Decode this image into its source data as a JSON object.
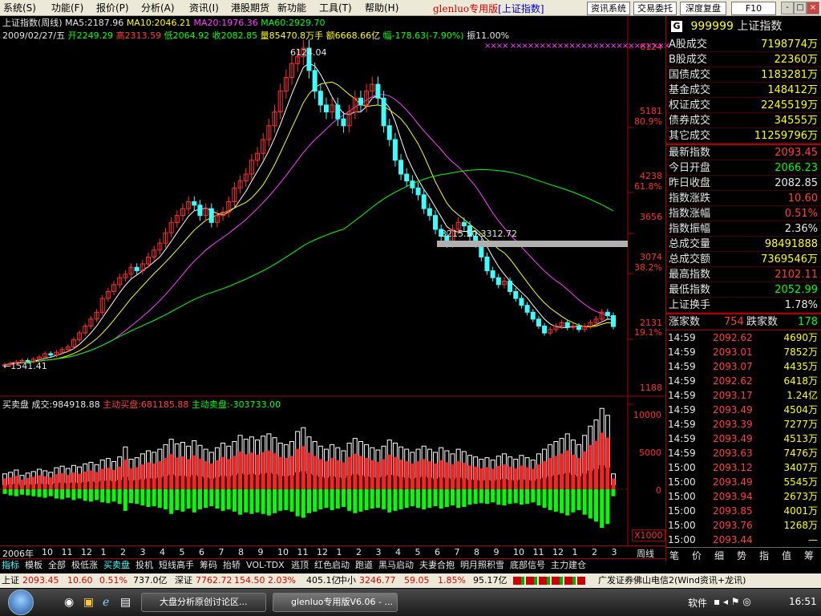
{
  "menu": {
    "items": [
      "系统(S)",
      "功能(F)",
      "报价(P)",
      "分析(A)",
      "资讯(I)",
      "港股期货",
      "新功能",
      "工具(T)",
      "帮助(H)"
    ],
    "app_name": "glenluo专用版",
    "app_index": "[上证指数]",
    "buttons": [
      "资讯系统",
      "交易委托",
      "深度复盘",
      "F10"
    ],
    "window_buttons": [
      "-",
      "□",
      "×"
    ]
  },
  "chart_header": {
    "line1": {
      "name": "上证指数(周线)",
      "ma5": "MA5:2187.96",
      "ma10": "MA10:2046.21",
      "ma20": "MA20:1976.36",
      "ma60": "MA60:2929.70"
    },
    "line2": {
      "date": "2009/02/27/五",
      "open": "开2249.29",
      "high": "高2313.59",
      "low": "低2064.92",
      "close": "收2082.85",
      "vol": "量85470.8万手",
      "amount": "额6668.66亿",
      "change": "幅-178.63(-7.90%)",
      "amp": "振11.00%"
    }
  },
  "price_axis_labels": [
    "6124",
    "5181",
    "80.9%",
    "4238",
    "61.8%",
    "3656",
    "3074",
    "38.2%",
    "2131",
    "19.1%",
    "1188"
  ],
  "annotations": {
    "peak": "6124.04",
    "low": "←1541.41",
    "gap": "3215.50-3312.72"
  },
  "sub_header": {
    "name": "买卖盘",
    "total": "成交:984918.88",
    "active_buy": "主动买盘:681185.88",
    "active_sell": "主动卖盘:-303733.00"
  },
  "sub_axis_labels": [
    "10000",
    "5000",
    "0"
  ],
  "sub_multiplier": "X1000",
  "time_axis": {
    "labels": [
      "2006年",
      "10",
      "11",
      "12",
      "1",
      "2",
      "3",
      "4",
      "5",
      "6",
      "7",
      "8",
      "9",
      "10",
      "11",
      "12",
      "1",
      "2",
      "3",
      "4",
      "5",
      "6",
      "7",
      "8",
      "9",
      "10",
      "11",
      "12",
      "1",
      "2",
      "3"
    ],
    "period": "周线"
  },
  "bottom_tabs": [
    "指标",
    "模板",
    "全部",
    "极低涨",
    "买卖盘",
    "投机",
    "短线高手",
    "筹码",
    "抬轿",
    "VOL-TDX",
    "逃顶",
    "红色启动",
    "跑道",
    "黑马启动",
    "夫妻合抱",
    "明月照积雪",
    "底部信号",
    "主力建仓"
  ],
  "right_panel": {
    "code": "999999",
    "name": "上证指数",
    "badge": "G",
    "volume_rows": [
      {
        "label": "A股成交",
        "value": "7198774万"
      },
      {
        "label": "B股成交",
        "value": "22360万"
      },
      {
        "label": "国债成交",
        "value": "1183281万"
      },
      {
        "label": "基金成交",
        "value": "148412万"
      },
      {
        "label": "权证成交",
        "value": "2245519万"
      },
      {
        "label": "债券成交",
        "value": "34555万"
      },
      {
        "label": "其它成交",
        "value": "11259796万"
      }
    ],
    "index_rows": [
      {
        "label": "最新指数",
        "value": "2093.45",
        "color": "#ff4040"
      },
      {
        "label": "今日开盘",
        "value": "2066.23",
        "color": "#00ff00"
      },
      {
        "label": "昨日收盘",
        "value": "2082.85",
        "color": "#e6e6e6"
      },
      {
        "label": "指数涨跌",
        "value": "10.60",
        "color": "#ff4040"
      },
      {
        "label": "指数涨幅",
        "value": "0.51%",
        "color": "#ff4040"
      },
      {
        "label": "指数振幅",
        "value": "2.36%",
        "color": "#e6e6e6"
      },
      {
        "label": "总成交量",
        "value": "98491888",
        "color": "#ffff00"
      },
      {
        "label": "总成交额",
        "value": "7369546万",
        "color": "#ffff00"
      },
      {
        "label": "最高指数",
        "value": "2102.11",
        "color": "#ff4040"
      },
      {
        "label": "最低指数",
        "value": "2052.99",
        "color": "#00ff00"
      },
      {
        "label": "上证换手",
        "value": "1.78%",
        "color": "#e6e6e6"
      }
    ],
    "advance_label": "涨家数",
    "advance_value": "754",
    "decline_label": "跌家数",
    "decline_value": "178",
    "trades": [
      {
        "time": "14:59",
        "price": "2092.62",
        "qty": "4690万"
      },
      {
        "time": "14:59",
        "price": "2093.01",
        "qty": "7852万"
      },
      {
        "time": "14:59",
        "price": "2093.07",
        "qty": "4435万"
      },
      {
        "time": "14:59",
        "price": "2092.62",
        "qty": "6418万"
      },
      {
        "time": "14:59",
        "price": "2093.17",
        "qty": "1.24亿"
      },
      {
        "time": "14:59",
        "price": "2093.49",
        "qty": "4504万"
      },
      {
        "time": "14:59",
        "price": "2093.39",
        "qty": "7277万"
      },
      {
        "time": "14:59",
        "price": "2093.49",
        "qty": "4513万"
      },
      {
        "time": "14:59",
        "price": "2093.63",
        "qty": "7476万"
      },
      {
        "time": "15:00",
        "price": "2093.12",
        "qty": "3407万"
      },
      {
        "time": "15:00",
        "price": "2093.49",
        "qty": "5545万"
      },
      {
        "time": "15:00",
        "price": "2093.94",
        "qty": "2673万"
      },
      {
        "time": "15:00",
        "price": "2093.85",
        "qty": "4001万"
      },
      {
        "time": "15:00",
        "price": "2093.76",
        "qty": "1268万"
      },
      {
        "time": "15:00",
        "price": "2093.44",
        "qty": "—"
      }
    ],
    "tabs": [
      "笔",
      "价",
      "细",
      "势",
      "指",
      "值",
      "筹"
    ]
  },
  "status_bar": {
    "sh_label": "上证",
    "sh_value": "2093.45",
    "sh_chg": "10.60",
    "sh_pct": "0.51%",
    "sh_amt": "737.0亿",
    "sz_label": "深证",
    "sz_value": "7762.72",
    "sz_chg": "154.50",
    "sz_pct": "2.03%",
    "sz_amt": "405.1亿",
    "zx_label": "中小",
    "zx_value": "3246.77",
    "zx_chg": "59.05",
    "zx_pct": "1.85%",
    "zx_amt": "95.17亿",
    "broker": "广发证券佛山电信2(Wind资讯+龙讯)"
  },
  "taskbar": {
    "tasks": [
      "大盘分析原创讨论区...",
      "glenluo专用版V6.06 - ..."
    ],
    "tray_label": "软件",
    "clock": "16:51"
  },
  "colors": {
    "up": "#ff3030",
    "down": "#40ffff",
    "ma5": "#ffffff",
    "ma10": "#ffff00",
    "ma20": "#ff40ff",
    "ma60": "#00ff00",
    "buy": "#ff2020",
    "sell": "#00ff00"
  },
  "chart_data": {
    "type": "candlestick",
    "title": "上证指数(周线)",
    "y_axis_labels": [
      6124,
      5181,
      4238,
      3656,
      3074,
      2131,
      1188
    ],
    "candles": [
      1541,
      1560,
      1580,
      1600,
      1590,
      1620,
      1650,
      1700,
      1680,
      1720,
      1760,
      1800,
      1900,
      2000,
      2100,
      2200,
      2300,
      2500,
      2600,
      2700,
      2800,
      2850,
      2950,
      2900,
      3000,
      3100,
      3200,
      3300,
      3450,
      3600,
      3700,
      3800,
      3900,
      3850,
      3700,
      3800,
      3600,
      3700,
      3750,
      3900,
      4100,
      4200,
      4300,
      4500,
      4600,
      4800,
      5000,
      5200,
      5500,
      5700,
      5900,
      6000,
      6124,
      5800,
      5500,
      5300,
      5200,
      5300,
      5100,
      5000,
      5200,
      5400,
      5300,
      5500,
      5600,
      5400,
      5000,
      4800,
      4500,
      4300,
      4200,
      4100,
      4000,
      3800,
      3700,
      3500,
      3400,
      3300,
      3500,
      3600,
      3550,
      3400,
      3300,
      3100,
      2900,
      2800,
      2700,
      2750,
      2600,
      2500,
      2400,
      2300,
      2200,
      2100,
      2000,
      2050,
      2100,
      2150,
      2080,
      2100,
      2050,
      2100,
      2150,
      2200,
      2300,
      2250,
      2093
    ],
    "sub_chart": {
      "type": "bar",
      "name": "买卖盘",
      "buy": [
        2000,
        2200,
        2500,
        1800,
        2100,
        2300,
        2600,
        2400,
        2200,
        2800,
        3000,
        2700,
        3100,
        2900,
        3300,
        3500,
        3200,
        3800,
        4000,
        3600,
        4200,
        5500,
        3900,
        4100,
        4600,
        5000,
        4800,
        5200,
        5800,
        6500,
        5900,
        6100,
        5600,
        6300,
        5700,
        5200,
        4800,
        5400,
        6000,
        5600,
        6200,
        7000,
        6500,
        6800,
        6400,
        6900,
        7200,
        6700,
        6000,
        5800,
        6200,
        7500,
        8000,
        6800,
        6200,
        5600,
        5200,
        5800,
        5400,
        5000,
        6000,
        6600,
        6200,
        5800,
        5400,
        5100,
        5600,
        6400,
        6000,
        5500,
        5200,
        4800,
        5200,
        5600,
        5200,
        4800,
        5400,
        5000,
        4600,
        5200,
        4900,
        4400,
        4200,
        3900,
        4100,
        3800,
        4300,
        4600,
        4200,
        3900,
        4400,
        4100,
        3800,
        4600,
        5200,
        5800,
        6200,
        6600,
        7200,
        6400,
        5800,
        7000,
        8200,
        9000,
        10500,
        9600,
        2000
      ],
      "sell": [
        -600,
        -800,
        -900,
        -700,
        -800,
        -900,
        -1000,
        -1100,
        -900,
        -1200,
        -1300,
        -1100,
        -1400,
        -1200,
        -1500,
        -1600,
        -1400,
        -1700,
        -1800,
        -1600,
        -1900,
        -2800,
        -1800,
        -1900,
        -2100,
        -2300,
        -2200,
        -2400,
        -2600,
        -3200,
        -2700,
        -2900,
        -2500,
        -3000,
        -2600,
        -2400,
        -2200,
        -2500,
        -2800,
        -2600,
        -2900,
        -3300,
        -3000,
        -3200,
        -3000,
        -3200,
        -3400,
        -3100,
        -2800,
        -2700,
        -2900,
        -3500,
        -3700,
        -3100,
        -2900,
        -2600,
        -2400,
        -2700,
        -2500,
        -2300,
        -2800,
        -3100,
        -2900,
        -2700,
        -2500,
        -2400,
        -2600,
        -3000,
        -2800,
        -2600,
        -2400,
        -2200,
        -2400,
        -2600,
        -2400,
        -2200,
        -2500,
        -2300,
        -2100,
        -2400,
        -2300,
        -2000,
        -1900,
        -1800,
        -1900,
        -1700,
        -2000,
        -2100,
        -1900,
        -1800,
        -2000,
        -1900,
        -1700,
        -2100,
        -2400,
        -2700,
        -2900,
        -3100,
        -3400,
        -3000,
        -2700,
        -3300,
        -3800,
        -4200,
        -5000,
        -4500,
        -900
      ]
    },
    "grid": false
  }
}
